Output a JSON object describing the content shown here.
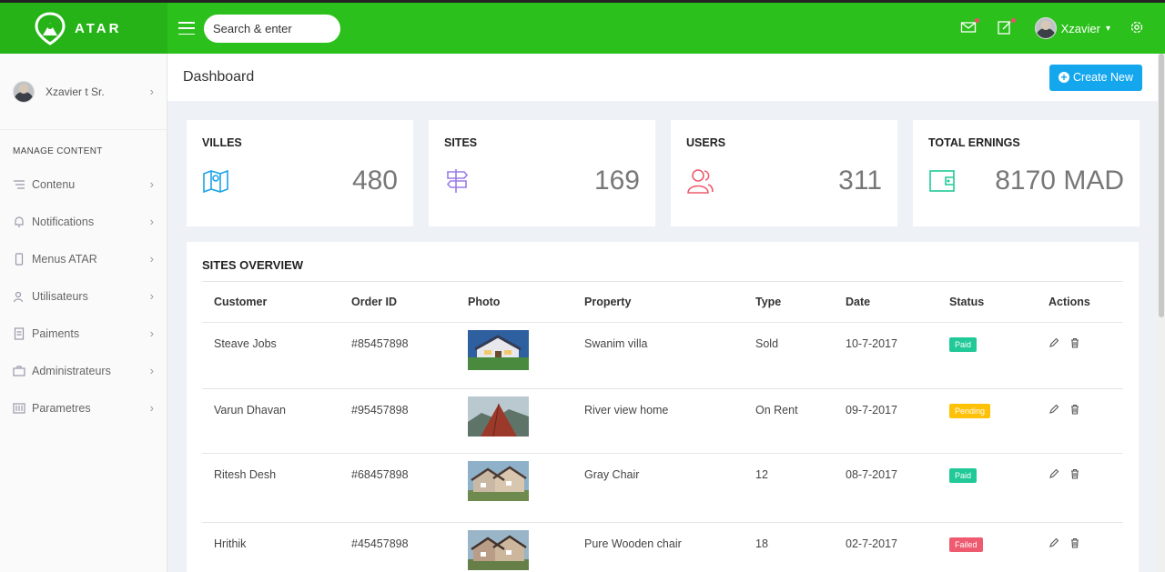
{
  "brand": {
    "name": "ATAR"
  },
  "topbar": {
    "search_placeholder": "Search & enter",
    "user_name": "Xzavier"
  },
  "sidebar": {
    "user_name": "Xzavier t Sr.",
    "heading": "MANAGE CONTENT",
    "items": [
      {
        "label": "Contenu",
        "icon": "list-icon"
      },
      {
        "label": "Notifications",
        "icon": "bell-icon"
      },
      {
        "label": "Menus ATAR",
        "icon": "mobile-icon"
      },
      {
        "label": "Utilisateurs",
        "icon": "users-icon"
      },
      {
        "label": "Paiments",
        "icon": "receipt-icon"
      },
      {
        "label": "Administrateurs",
        "icon": "briefcase-icon"
      },
      {
        "label": "Parametres",
        "icon": "sliders-icon"
      }
    ]
  },
  "page": {
    "title": "Dashboard",
    "create_label": "Create New"
  },
  "stats": [
    {
      "label": "VILLES",
      "value": "480",
      "icon": "map-icon",
      "color": "#1aa3e8"
    },
    {
      "label": "SITES",
      "value": "169",
      "icon": "signpost-icon",
      "color": "#9a7be8"
    },
    {
      "label": "USERS",
      "value": "311",
      "icon": "users-icon",
      "color": "#ee5a6f"
    },
    {
      "label": "TOTAL ERNINGS",
      "value": "8170 MAD",
      "icon": "wallet-icon",
      "color": "#20c997"
    }
  ],
  "overview": {
    "title": "SITES OVERVIEW",
    "columns": [
      "Customer",
      "Order ID",
      "Photo",
      "Property",
      "Type",
      "Date",
      "Status",
      "Actions"
    ],
    "rows": [
      {
        "customer": "Steave Jobs",
        "order_id": "#85457898",
        "property": "Swanim villa",
        "type": "Sold",
        "date": "10-7-2017",
        "status": "Paid",
        "status_color": "#20c997"
      },
      {
        "customer": "Varun Dhavan",
        "order_id": "#95457898",
        "property": "River view home",
        "type": "On Rent",
        "date": "09-7-2017",
        "status": "Pending",
        "status_color": "#ffc107"
      },
      {
        "customer": "Ritesh Desh",
        "order_id": "#68457898",
        "property": "Gray Chair",
        "type": "12",
        "date": "08-7-2017",
        "status": "Paid",
        "status_color": "#20c997"
      },
      {
        "customer": "Hrithik",
        "order_id": "#45457898",
        "property": "Pure Wooden chair",
        "type": "18",
        "date": "02-7-2017",
        "status": "Failed",
        "status_color": "#ee5a6f"
      }
    ]
  },
  "colors": {
    "topbar": "#2cc01c",
    "brand_bg": "#26b317",
    "primary_button": "#14a7ee"
  }
}
